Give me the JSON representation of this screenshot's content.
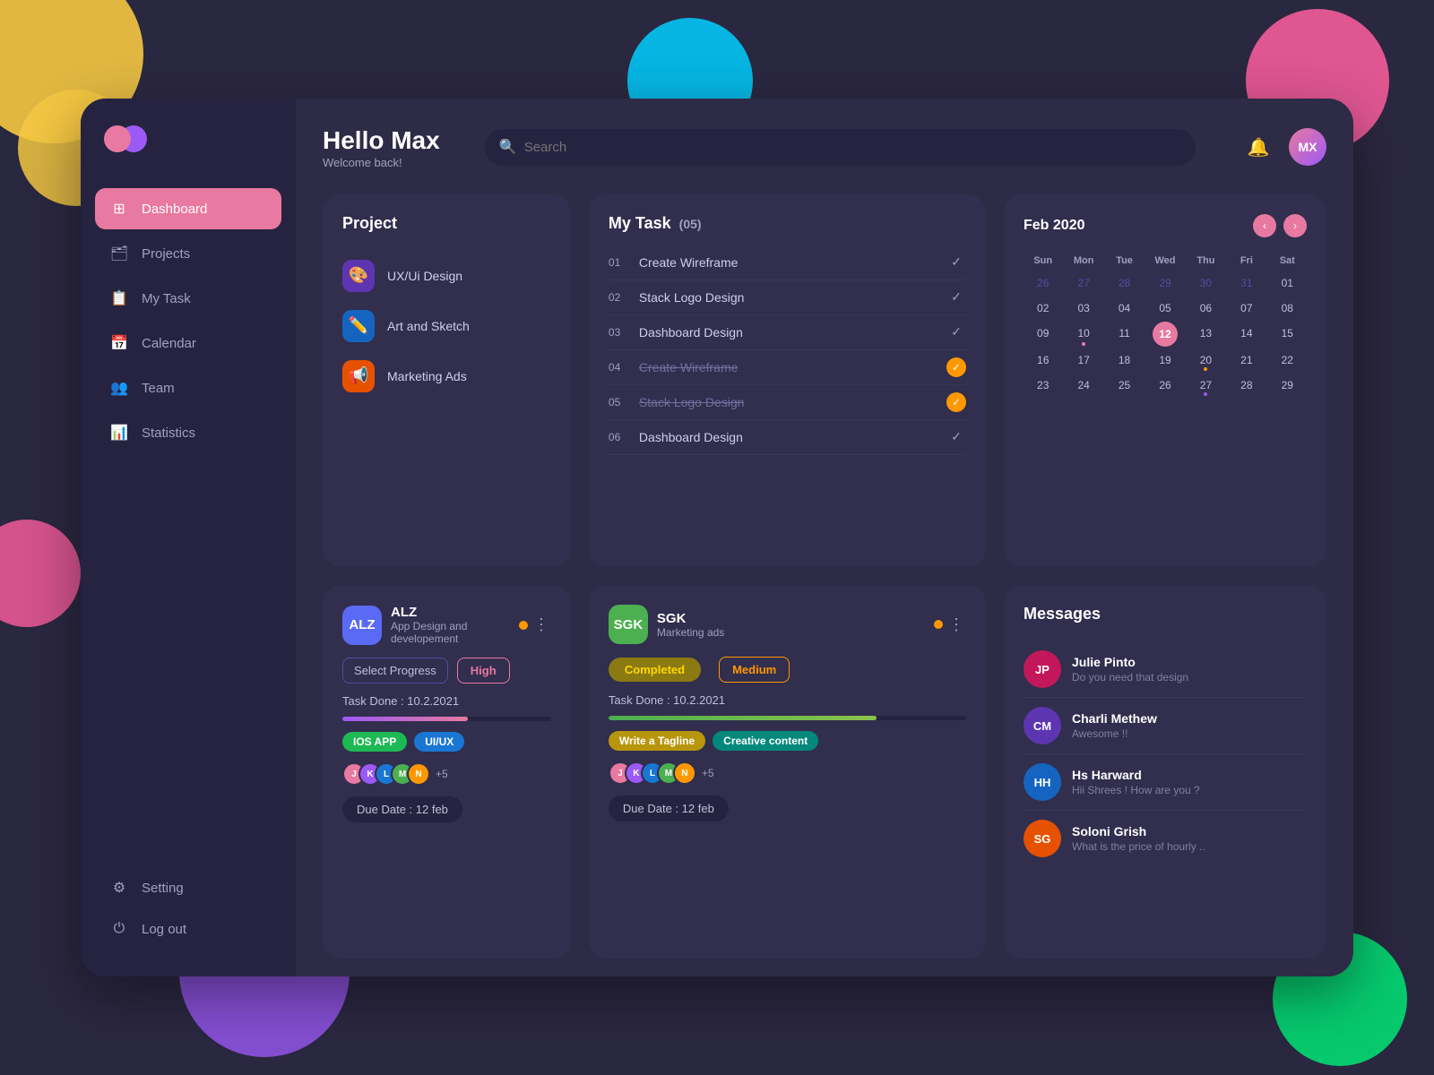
{
  "bg": {
    "colors": {
      "body": "#2a2740",
      "blob_yellow": "#f5c842",
      "blob_cyan": "#00cfff",
      "blob_pink": "#ff5fa0",
      "blob_purple": "#9b59f5",
      "blob_green": "#00e676"
    }
  },
  "sidebar": {
    "logo_label": "App Logo",
    "nav_items": [
      {
        "id": "dashboard",
        "label": "Dashboard",
        "icon": "⊞",
        "active": true
      },
      {
        "id": "projects",
        "label": "Projects",
        "icon": "📁",
        "active": false
      },
      {
        "id": "mytask",
        "label": "My Task",
        "icon": "📋",
        "active": false
      },
      {
        "id": "calendar",
        "label": "Calendar",
        "icon": "📅",
        "active": false
      },
      {
        "id": "team",
        "label": "Team",
        "icon": "👥",
        "active": false
      },
      {
        "id": "statistics",
        "label": "Statistics",
        "icon": "📊",
        "active": false
      },
      {
        "id": "setting",
        "label": "Setting",
        "icon": "⚙",
        "active": false
      },
      {
        "id": "logout",
        "label": "Log out",
        "icon": "⏻",
        "active": false
      }
    ]
  },
  "header": {
    "greeting": "Hello Max",
    "subtitle": "Welcome back!",
    "search_placeholder": "Search",
    "bell_label": "Notifications",
    "avatar_label": "MX"
  },
  "project_card": {
    "title": "Project",
    "items": [
      {
        "name": "UX/Ui Design",
        "icon": "🎨",
        "color": "#5e35b1"
      },
      {
        "name": "Art and Sketch",
        "icon": "✏️",
        "color": "#1565c0"
      },
      {
        "name": "Marketing Ads",
        "icon": "📢",
        "color": "#e65100"
      }
    ]
  },
  "task_card": {
    "title": "My Task",
    "count": "05",
    "tasks": [
      {
        "num": "01",
        "name": "Create Wireframe",
        "done": false,
        "check": "tick"
      },
      {
        "num": "02",
        "name": "Stack Logo Design",
        "done": false,
        "check": "tick"
      },
      {
        "num": "03",
        "name": "Dashboard Design",
        "done": false,
        "check": "tick"
      },
      {
        "num": "04",
        "name": "Create Wireframe",
        "done": true,
        "check": "orange"
      },
      {
        "num": "05",
        "name": "Stack Logo Design",
        "done": true,
        "check": "orange"
      },
      {
        "num": "06",
        "name": "Dashboard Design",
        "done": false,
        "check": "tick"
      }
    ]
  },
  "calendar": {
    "title": "Feb 2020",
    "days_header": [
      "Sun",
      "Mon",
      "Tue",
      "Wed",
      "Thu",
      "Fri",
      "Sat"
    ],
    "weeks": [
      [
        {
          "num": "26",
          "class": "prev"
        },
        {
          "num": "27",
          "class": "prev"
        },
        {
          "num": "28",
          "class": "prev"
        },
        {
          "num": "29",
          "class": "prev"
        },
        {
          "num": "30",
          "class": "prev"
        },
        {
          "num": "31",
          "class": "prev"
        },
        {
          "num": "01",
          "class": ""
        }
      ],
      [
        {
          "num": "02",
          "class": ""
        },
        {
          "num": "03",
          "class": ""
        },
        {
          "num": "04",
          "class": ""
        },
        {
          "num": "05",
          "class": ""
        },
        {
          "num": "06",
          "class": ""
        },
        {
          "num": "07",
          "class": ""
        },
        {
          "num": "08",
          "class": ""
        }
      ],
      [
        {
          "num": "09",
          "class": ""
        },
        {
          "num": "10",
          "class": "has-dot"
        },
        {
          "num": "11",
          "class": ""
        },
        {
          "num": "12",
          "class": "today"
        },
        {
          "num": "13",
          "class": ""
        },
        {
          "num": "14",
          "class": ""
        },
        {
          "num": "15",
          "class": ""
        }
      ],
      [
        {
          "num": "16",
          "class": ""
        },
        {
          "num": "17",
          "class": ""
        },
        {
          "num": "18",
          "class": ""
        },
        {
          "num": "19",
          "class": ""
        },
        {
          "num": "20",
          "class": "has-dot dot-orange"
        },
        {
          "num": "21",
          "class": ""
        },
        {
          "num": "22",
          "class": ""
        }
      ],
      [
        {
          "num": "23",
          "class": ""
        },
        {
          "num": "24",
          "class": ""
        },
        {
          "num": "25",
          "class": ""
        },
        {
          "num": "26",
          "class": ""
        },
        {
          "num": "27",
          "class": "has-dot-purple has-dot"
        },
        {
          "num": "28",
          "class": ""
        },
        {
          "num": "29",
          "class": ""
        }
      ]
    ]
  },
  "alz_card": {
    "badge": "ALZ",
    "badge_color": "#5b6af5",
    "name": "ALZ",
    "subtitle": "App Design and  developement",
    "progress_label": "Select Progress",
    "priority": "High",
    "task_done": "Task Done : 10.2.2021",
    "progress_pct": 60,
    "tags": [
      "IOS APP",
      "UI/UX"
    ],
    "due_date": "Due Date : 12 feb",
    "avatars": [
      "#e879a0",
      "#9b59f5",
      "#1976d2",
      "#4caf50",
      "#ff9800"
    ],
    "extra_count": "+5"
  },
  "sgk_card": {
    "badge": "SGK",
    "badge_color": "#4caf50",
    "name": "SGK",
    "subtitle": "Marketing ads",
    "status": "Completed",
    "priority": "Medium",
    "task_done": "Task Done : 10.2.2021",
    "progress_pct": 75,
    "tags": [
      "Write a Tagline",
      "Creative content"
    ],
    "due_date": "Due Date : 12 feb",
    "avatars": [
      "#e879a0",
      "#9b59f5",
      "#1976d2",
      "#4caf50",
      "#ff9800"
    ],
    "extra_count": "+5"
  },
  "messages": {
    "title": "Messages",
    "items": [
      {
        "name": "Julie Pinto",
        "preview": "Do you need that design",
        "color": "#c2185b"
      },
      {
        "name": "Charli Methew",
        "preview": "Awesome !!",
        "color": "#5e35b1"
      },
      {
        "name": "Hs Harward",
        "preview": "Hii Shrees ! How are you ?",
        "color": "#1565c0"
      },
      {
        "name": "Soloni Grish",
        "preview": "What is the price of hourly ..",
        "color": "#e65100"
      }
    ]
  }
}
